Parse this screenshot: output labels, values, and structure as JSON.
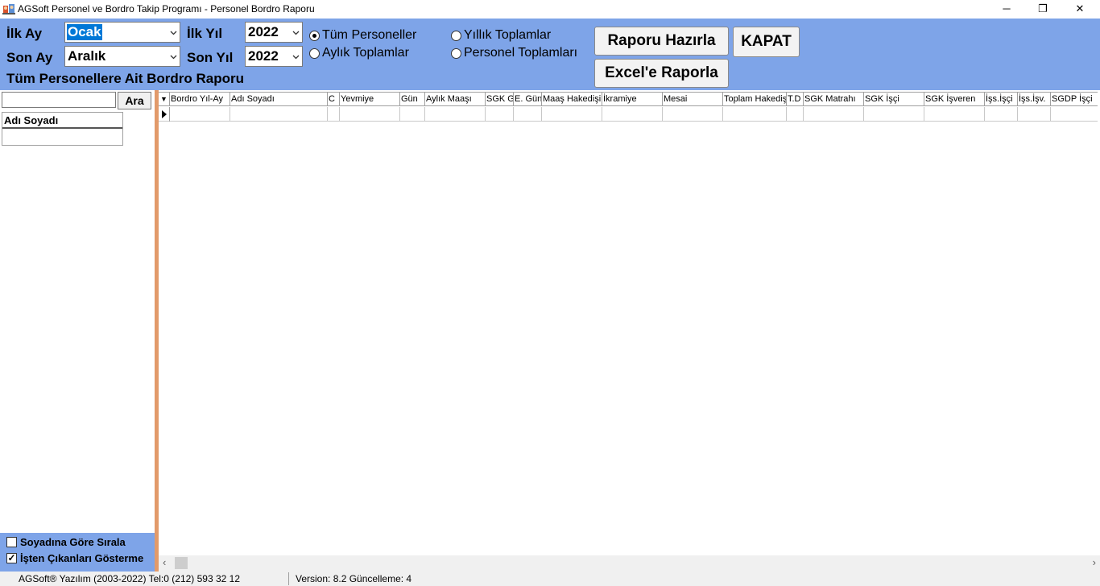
{
  "window": {
    "title": "AGSoft Personel ve Bordro Takip Programı - Personel Bordro Raporu",
    "minimize": "─",
    "restore": "❐",
    "close": "✕"
  },
  "filters": {
    "ilk_ay_label": "İlk Ay",
    "ilk_ay_value": "Ocak",
    "son_ay_label": "Son Ay",
    "son_ay_value": "Aralık",
    "ilk_yil_label": "İlk Yıl",
    "ilk_yil_value": "2022",
    "son_yil_label": "Son Yıl",
    "son_yil_value": "2022",
    "report_caption": "Tüm Personellere Ait Bordro Raporu"
  },
  "options": {
    "tum_personeller": "Tüm Personeller",
    "aylik_toplamlar": "Aylık Toplamlar",
    "yillik_toplamlar": "Yıllık Toplamlar",
    "personel_toplamlari": "Personel Toplamları",
    "selected": "tum_personeller"
  },
  "buttons": {
    "raporu_hazirla": "Raporu Hazırla",
    "kapat": "KAPAT",
    "excel": "Excel'e Raporla",
    "ara": "Ara"
  },
  "left": {
    "search_value": "",
    "column_header": "Adı Soyadı",
    "sort_by_surname": "Soyadına Göre Sırala",
    "sort_by_surname_checked": false,
    "hide_leavers": "İşten Çıkanları Gösterme",
    "hide_leavers_checked": true
  },
  "grid": {
    "columns": [
      "Bordro Yıl-Ay",
      "Adı Soyadı",
      "C",
      "Yevmiye",
      "Gün",
      "Aylık Maaşı",
      "SGK G.",
      "E. Gün",
      "Maaş Hakedişi",
      "İkramiye",
      "Mesai",
      "Toplam Hakediş",
      "T.D",
      "SGK Matrahı",
      "SGK İşçi",
      "SGK İşveren",
      "İşs.İşçi",
      "İşs.İşv.",
      "SGDP İşçi"
    ]
  },
  "status": {
    "company": "AGSoft® Yazılım (2003-2022) Tel:0 (212) 593 32 12",
    "version": "Version: 8.2 Güncelleme: 4"
  },
  "colors": {
    "panel_blue": "#7ea4e8",
    "splitter_orange": "#e29a6a",
    "selection_blue": "#0078d7"
  }
}
